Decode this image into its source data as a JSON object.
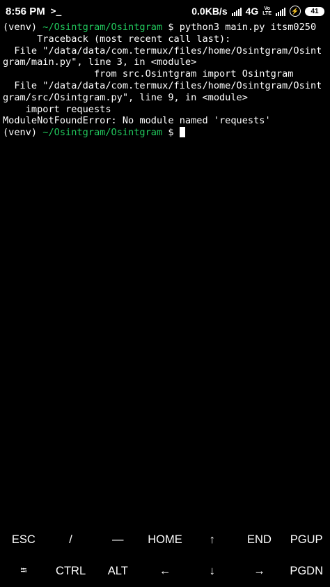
{
  "status_bar": {
    "time": "8:56 PM",
    "app_icon": "termux-icon",
    "network_speed": "0.0KB/s",
    "network_type": "4G",
    "volte_top": "Vo",
    "volte_bottom": "LTE",
    "battery": "41"
  },
  "terminal": {
    "lines": [
      {
        "segments": [
          {
            "text": "(venv) "
          },
          {
            "text": "~/Osintgram/Osintgram",
            "color": "green"
          },
          {
            "text": " $ python3 main.py itsm0250"
          }
        ]
      },
      {
        "segments": [
          {
            "text": "      Traceback (most recent call last):"
          }
        ]
      },
      {
        "segments": [
          {
            "text": "  File \"/data/data/com.termux/files/home/Osintgram/Osint"
          }
        ]
      },
      {
        "segments": [
          {
            "text": "gram/main.py\", line 3, in <module>"
          }
        ]
      },
      {
        "segments": [
          {
            "text": "                from src.Osintgram import Osintgram"
          }
        ]
      },
      {
        "segments": [
          {
            "text": "  File \"/data/data/com.termux/files/home/Osintgram/Osint"
          }
        ]
      },
      {
        "segments": [
          {
            "text": "gram/src/Osintgram.py\", line 9, in <module>"
          }
        ]
      },
      {
        "segments": [
          {
            "text": "    import requests"
          }
        ]
      },
      {
        "segments": [
          {
            "text": "ModuleNotFoundError: No module named 'requests'"
          }
        ]
      },
      {
        "segments": [
          {
            "text": "(venv) "
          },
          {
            "text": "~/Osintgram/Osintgram",
            "color": "green"
          },
          {
            "text": " $ "
          }
        ],
        "cursor": true
      }
    ]
  },
  "extra_keys": {
    "row1": [
      "ESC",
      "/",
      "—",
      "HOME",
      "↑",
      "END",
      "PGUP"
    ],
    "row2": [
      "⭾",
      "CTRL",
      "ALT",
      "←",
      "↓",
      "→",
      "PGDN"
    ]
  },
  "colors": {
    "background": "#000000",
    "prompt_path": "#21c75c",
    "text": "#ffffff"
  }
}
